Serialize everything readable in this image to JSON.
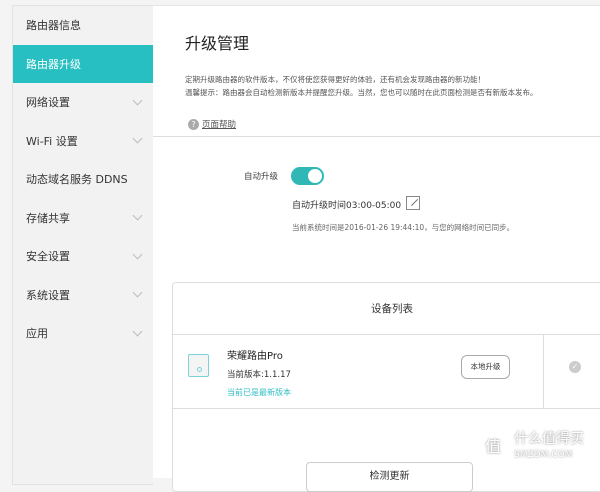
{
  "sidebar": {
    "items": [
      {
        "label": "路由器信息",
        "active": false,
        "expandable": false
      },
      {
        "label": "路由器升级",
        "active": true,
        "expandable": false
      },
      {
        "label": "网络设置",
        "active": false,
        "expandable": true
      },
      {
        "label": "Wi-Fi 设置",
        "active": false,
        "expandable": true
      },
      {
        "label": "动态域名服务 DDNS",
        "active": false,
        "expandable": false
      },
      {
        "label": "存储共享",
        "active": false,
        "expandable": true
      },
      {
        "label": "安全设置",
        "active": false,
        "expandable": true
      },
      {
        "label": "系统设置",
        "active": false,
        "expandable": true
      },
      {
        "label": "应用",
        "active": false,
        "expandable": true
      }
    ]
  },
  "main": {
    "title": "升级管理",
    "desc1": "定期升级路由器的软件版本，不仅将使您获得更好的体验，还有机会发现路由器的新功能！",
    "desc2": "温馨提示：路由器会自动检测新版本并提醒您升级。当然，您也可以随时在此页面检测是否有新版本发布。",
    "help": "页面帮助",
    "auto_label": "自动升级",
    "auto_enabled": true,
    "auto_time": "自动升级时间03:00-05:00",
    "system_time": "当前系统时间是2016-01-26 19:44:10，与您的网络时间已同步。"
  },
  "devices": {
    "header": "设备列表",
    "name": "荣耀路由Pro",
    "version": "当前版本:1.1.17",
    "status": "当前已是最新版本",
    "local_upgrade": "本地升级",
    "check_update": "检测更新"
  },
  "watermark": {
    "char": "值",
    "text": "什么值得买",
    "sub": "SMZDM.COM"
  },
  "colors": {
    "accent": "#27bfc1"
  }
}
